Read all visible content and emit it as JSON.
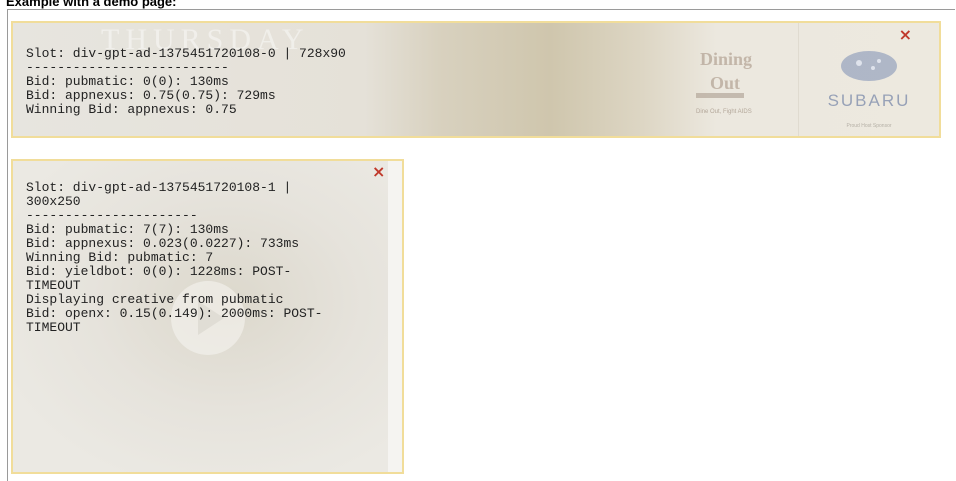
{
  "page": {
    "heading": "Example with a demo page:"
  },
  "ad_top": {
    "ghost_title": "THURSDAY",
    "close_glyph": "×",
    "lines": [
      "Slot: div-gpt-ad-1375451720108-0 | 728x90",
      "--------------------------",
      "Bid: pubmatic: 0(0): 130ms",
      "Bid: appnexus: 0.75(0.75): 729ms",
      "Winning Bid: appnexus: 0.75"
    ],
    "logo_dining_1": "Dining",
    "logo_dining_2": "Out",
    "logo_dining_tagline": "Dine Out, Fight AIDS",
    "logo_subaru": "SUBARU",
    "logo_subaru_tagline": "Proud Host Sponsor"
  },
  "ad_bottom": {
    "close_glyph": "×",
    "lines": [
      "Slot: div-gpt-ad-1375451720108-1 |",
      "300x250",
      "----------------------",
      "Bid: pubmatic: 7(7): 130ms",
      "Bid: appnexus: 0.023(0.0227): 733ms",
      "Winning Bid: pubmatic: 7",
      "Bid: yieldbot: 0(0): 1228ms: POST-",
      "TIMEOUT",
      "Displaying creative from pubmatic",
      "Bid: openx: 0.15(0.149): 2000ms: POST-",
      "TIMEOUT"
    ]
  },
  "colors": {
    "panel_border": "#f1dd9a",
    "close_red": "#c0392b",
    "subaru_blue": "#2a4f96"
  }
}
